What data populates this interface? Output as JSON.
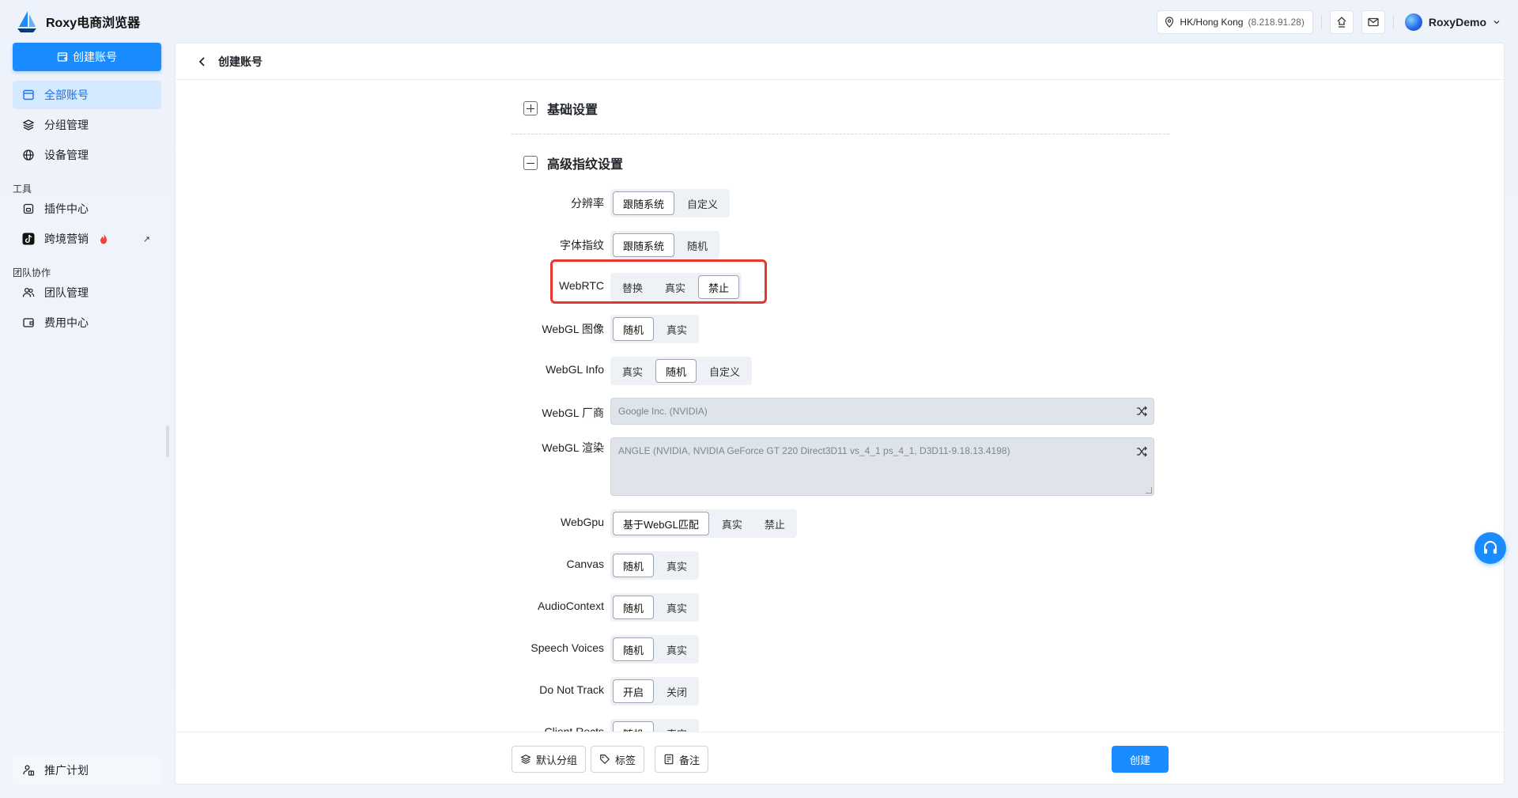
{
  "app": {
    "title": "Roxy电商浏览器"
  },
  "topbar": {
    "location": "HK/Hong Kong",
    "ip": "(8.218.91.28)",
    "username": "RoxyDemo"
  },
  "sidebar": {
    "create_label": "创建账号",
    "items": [
      {
        "label": "全部账号"
      },
      {
        "label": "分组管理"
      },
      {
        "label": "设备管理"
      }
    ],
    "tools_group": "工具",
    "tools": [
      {
        "label": "插件中心"
      },
      {
        "label": "跨境营销"
      }
    ],
    "team_group": "团队协作",
    "team": [
      {
        "label": "团队管理"
      },
      {
        "label": "费用中心"
      }
    ],
    "promo_label": "推广计划"
  },
  "page": {
    "back_title": "创建账号",
    "basic_section": "基础设置",
    "advanced_section": "高级指纹设置"
  },
  "fingerprint": {
    "resolution": {
      "label": "分辨率",
      "options": [
        "跟随系统",
        "自定义"
      ],
      "selected": "跟随系统"
    },
    "font": {
      "label": "字体指纹",
      "options": [
        "跟随系统",
        "随机"
      ],
      "selected": "跟随系统"
    },
    "webrtc": {
      "label": "WebRTC",
      "options": [
        "替换",
        "真实",
        "禁止"
      ],
      "selected": "禁止"
    },
    "webgl_image": {
      "label": "WebGL 图像",
      "options": [
        "随机",
        "真实"
      ],
      "selected": "随机"
    },
    "webgl_info": {
      "label": "WebGL Info",
      "options": [
        "真实",
        "随机",
        "自定义"
      ],
      "selected": "随机"
    },
    "webgl_vendor": {
      "label": "WebGL 厂商",
      "value": "Google Inc. (NVIDIA)"
    },
    "webgl_renderer": {
      "label": "WebGL 渲染",
      "value": "ANGLE (NVIDIA, NVIDIA GeForce GT 220  Direct3D11 vs_4_1 ps_4_1, D3D11-9.18.13.4198)"
    },
    "webgpu": {
      "label": "WebGpu",
      "options": [
        "基于WebGL匹配",
        "真实",
        "禁止"
      ],
      "selected": "基于WebGL匹配"
    },
    "canvas": {
      "label": "Canvas",
      "options": [
        "随机",
        "真实"
      ],
      "selected": "随机"
    },
    "audio": {
      "label": "AudioContext",
      "options": [
        "随机",
        "真实"
      ],
      "selected": "随机"
    },
    "speech": {
      "label": "Speech Voices",
      "options": [
        "随机",
        "真实"
      ],
      "selected": "随机"
    },
    "dnt": {
      "label": "Do Not Track",
      "options": [
        "开启",
        "关闭"
      ],
      "selected": "开启"
    },
    "client_rects": {
      "label": "Client Rects",
      "options": [
        "随机",
        "真实"
      ],
      "selected": "随机"
    }
  },
  "footer": {
    "group_label": "默认分组",
    "tag_label": "标签",
    "note_label": "备注",
    "submit_label": "创建"
  }
}
